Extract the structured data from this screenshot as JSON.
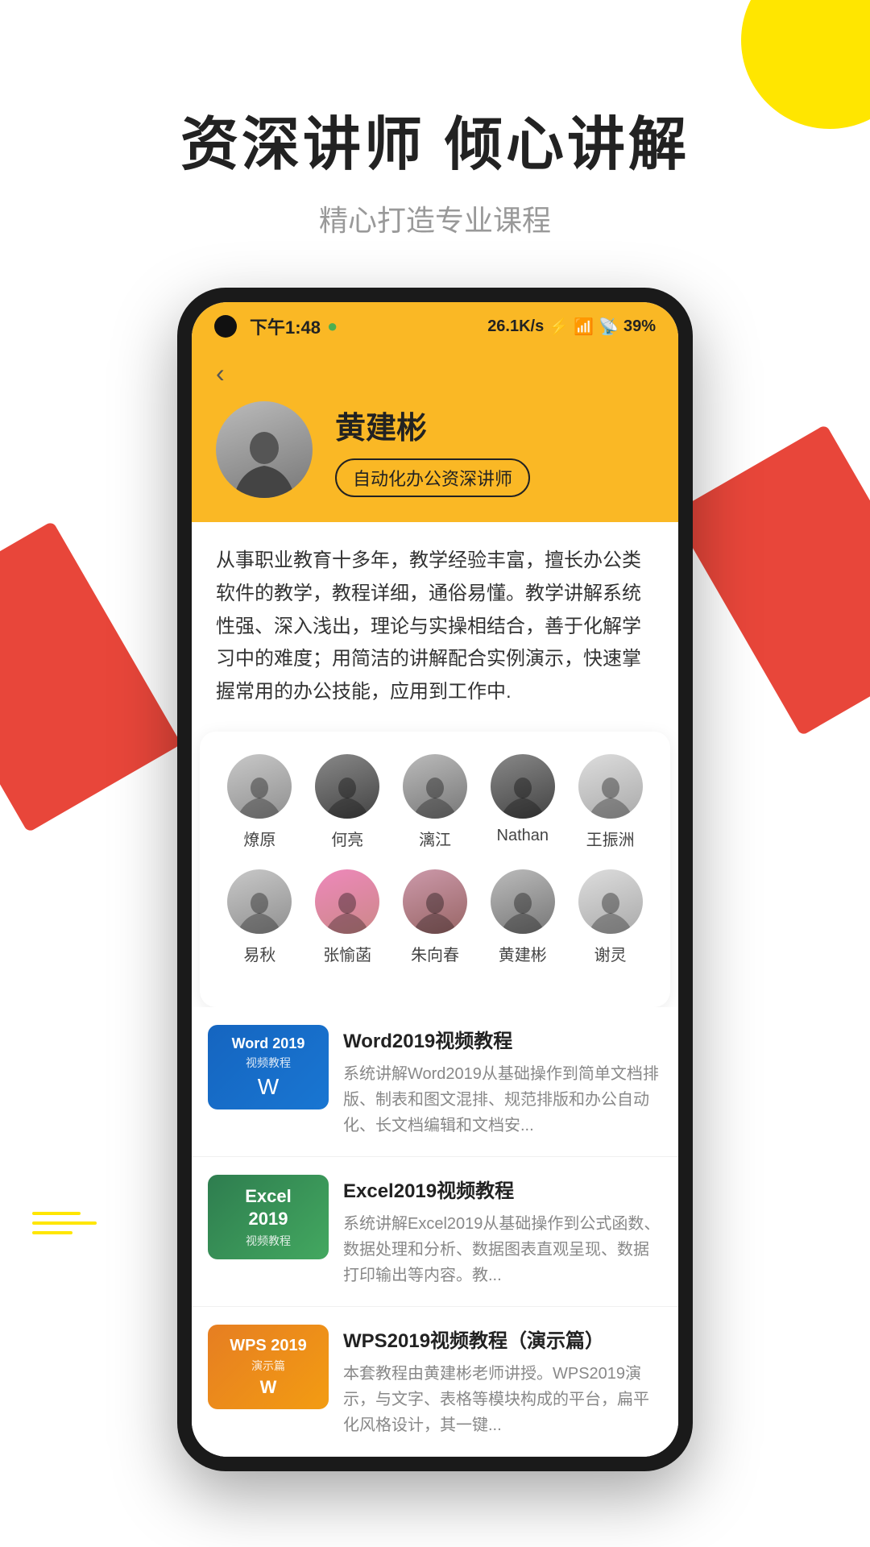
{
  "page": {
    "background_color": "#ffffff",
    "deco_circle_color": "#FFE600",
    "deco_red_color": "#E8463A"
  },
  "hero": {
    "title": "资深讲师  倾心讲解",
    "subtitle": "精心打造专业课程"
  },
  "phone": {
    "status_bar": {
      "time": "下午1:48",
      "speed": "26.1K/s",
      "battery": "39%"
    },
    "teacher": {
      "name": "黄建彬",
      "badge": "自动化办公资深讲师",
      "bio": "从事职业教育十多年，教学经验丰富，擅长办公类软件的教学，教程详细，通俗易懂。教学讲解系统性强、深入浅出，理论与实操相结合，善于化解学习中的难度；用简洁的讲解配合实例演示，快速掌握常用的办公技能，应用到工作中."
    },
    "instructors_row1": [
      {
        "name": "燎原",
        "avatar_style": "av-gray"
      },
      {
        "name": "何亮",
        "avatar_style": "av-dark"
      },
      {
        "name": "漓江",
        "avatar_style": "av-mid"
      },
      {
        "name": "Nathan",
        "avatar_style": "av-dark"
      },
      {
        "name": "王振洲",
        "avatar_style": "av-light"
      }
    ],
    "instructors_row2": [
      {
        "name": "易秋",
        "avatar_style": "av-gray"
      },
      {
        "name": "张愉菡",
        "avatar_style": "av-pink"
      },
      {
        "name": "朱向春",
        "avatar_style": "av-warm"
      },
      {
        "name": "黄建彬",
        "avatar_style": "av-mid"
      },
      {
        "name": "谢灵",
        "avatar_style": "av-light"
      }
    ],
    "courses": [
      {
        "id": "word2019",
        "title": "Word2019视频教程",
        "desc": "系统讲解Word2019从基础操作到简单文档排版、制表和图文混排、规范排版和办公自动化、长文档编辑和文档安...",
        "thumb_type": "word",
        "thumb_line1": "Word 2019",
        "thumb_line2": "视频教程"
      },
      {
        "id": "excel2019",
        "title": "Excel2019视频教程",
        "desc": "系统讲解Excel2019从基础操作到公式函数、数据处理和分析、数据图表直观呈现、数据打印输出等内容。教...",
        "thumb_type": "excel",
        "thumb_line1": "Excel",
        "thumb_line2": "2019\n视频教程"
      },
      {
        "id": "wps2019",
        "title": "WPS2019视频教程（演示篇）",
        "desc": "本套教程由黄建彬老师讲授。WPS2019演示，与文字、表格等模块构成的平台，扁平化风格设计，其一键...",
        "thumb_type": "wps",
        "thumb_line1": "WPS 2019",
        "thumb_line2": "演示篇"
      }
    ]
  }
}
